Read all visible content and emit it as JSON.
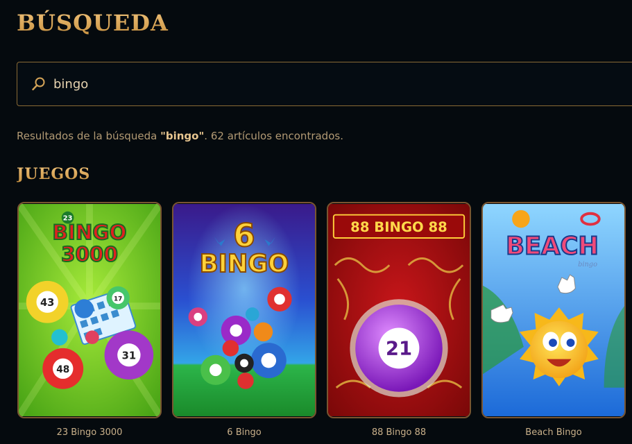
{
  "header": {
    "title": "BÚSQUEDA"
  },
  "search": {
    "value": "bingo",
    "icon": "search-icon"
  },
  "results": {
    "prefix": "Resultados de la búsqueda ",
    "query": "\"bingo\"",
    "suffix": ". 62 artículos encontrados."
  },
  "sections": {
    "games_title": "JUEGOS"
  },
  "games": [
    {
      "name": "23 Bingo 3000",
      "art": {
        "line1": "BINGO",
        "line2": "3000",
        "badge": "23"
      },
      "balls": [
        "43",
        "17",
        "31",
        "48"
      ]
    },
    {
      "name": "6 Bingo",
      "art": {
        "line1": "6",
        "line2": "BINGO"
      }
    },
    {
      "name": "88 Bingo 88",
      "art": {
        "line1": "88 BINGO 88",
        "ball": "21"
      }
    },
    {
      "name": "Beach Bingo",
      "art": {
        "line1": "BEACH",
        "line2": "bingo"
      }
    }
  ],
  "colors": {
    "background": "#050a0e",
    "gold": "#d4a458",
    "border": "#8a6a35"
  }
}
